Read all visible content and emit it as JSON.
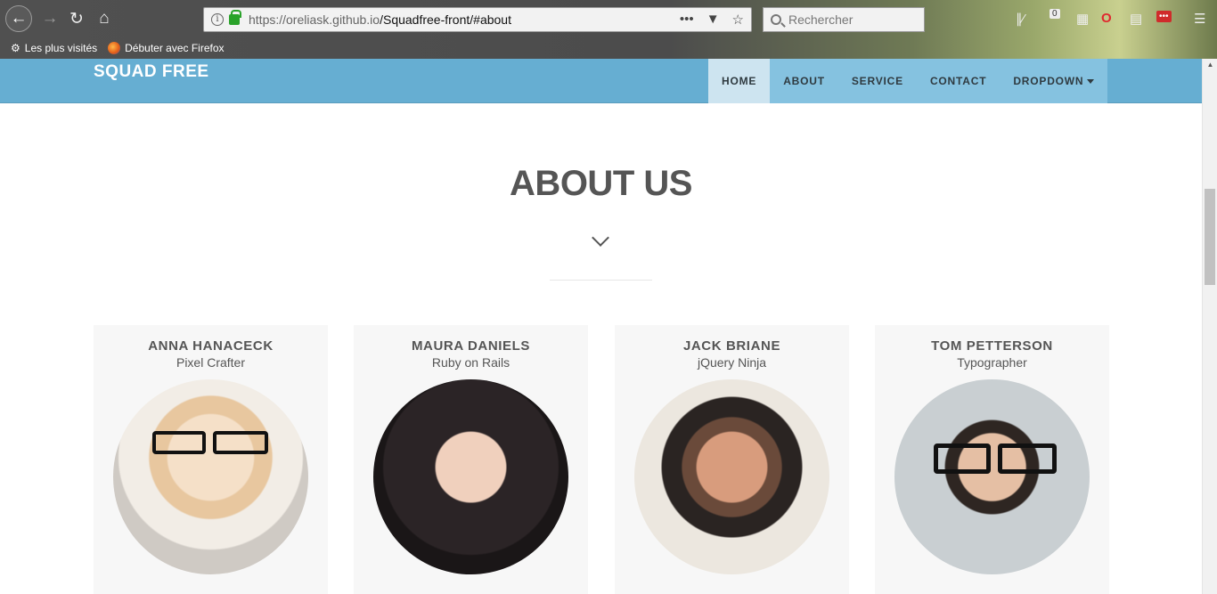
{
  "browser": {
    "url_host": "https://oreliask.github.io",
    "url_path": "/Squadfree-front/#about",
    "search_placeholder": "Rechercher",
    "bookmarks": [
      {
        "label": "Les plus visités"
      },
      {
        "label": "Débuter avec Firefox"
      }
    ],
    "badge_count": "0"
  },
  "site": {
    "brand": "SQUAD FREE",
    "menu": [
      {
        "label": "HOME",
        "active": true
      },
      {
        "label": "ABOUT"
      },
      {
        "label": "SERVICE"
      },
      {
        "label": "CONTACT"
      },
      {
        "label": "DROPDOWN"
      }
    ],
    "section_title": "ABOUT US",
    "team": [
      {
        "name": "ANNA HANACECK",
        "role": "Pixel Crafter"
      },
      {
        "name": "MAURA DANIELS",
        "role": "Ruby on Rails"
      },
      {
        "name": "JACK BRIANE",
        "role": "jQuery Ninja"
      },
      {
        "name": "TOM PETTERSON",
        "role": "Typographer"
      }
    ]
  },
  "colors": {
    "header": "#66aed2",
    "title": "#555555"
  }
}
